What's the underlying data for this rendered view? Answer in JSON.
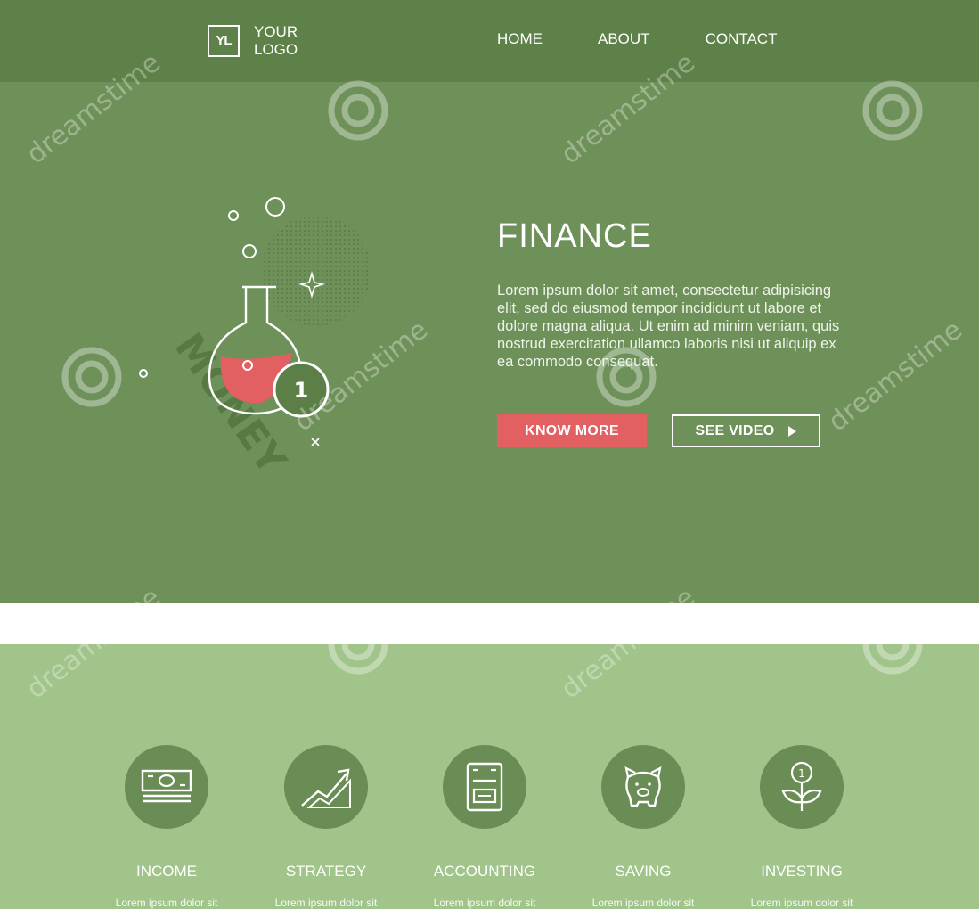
{
  "header": {
    "logo_mark": "YL",
    "logo_line1": "YOUR",
    "logo_line2": "LOGO",
    "nav": [
      {
        "label": "HOME",
        "active": true
      },
      {
        "label": "ABOUT",
        "active": false
      },
      {
        "label": "CONTACT",
        "active": false
      }
    ]
  },
  "hero": {
    "title": "FINANCE",
    "text": "Lorem ipsum dolor sit amet, consectetur adipisicing elit, sed do eiusmod tempor incididunt ut labore et dolore magna aliqua. Ut enim ad minim veniam, quis nostrud exercitation ullamco laboris nisi ut aliquip ex ea commodo consequat.",
    "primary_button": "KNOW MORE",
    "secondary_button": "SEE VIDEO",
    "illustration_word": "MONEY",
    "coin_number": "1"
  },
  "features": [
    {
      "label": "INCOME",
      "text": "Lorem ipsum dolor sit",
      "icon": "banknote-icon"
    },
    {
      "label": "STRATEGY",
      "text": "Lorem ipsum dolor sit",
      "icon": "growth-chart-icon"
    },
    {
      "label": "ACCOUNTING",
      "text": "Lorem ipsum dolor sit",
      "icon": "calculator-icon"
    },
    {
      "label": "SAVING",
      "text": "Lorem ipsum dolor sit",
      "icon": "piggy-bank-icon"
    },
    {
      "label": "INVESTING",
      "text": "Lorem ipsum dolor sit",
      "icon": "money-plant-icon"
    }
  ],
  "watermark": "dreamstime",
  "colors": {
    "header": "#5d8148",
    "hero": "#6e9159",
    "features": "#a1c48a",
    "icon_circle": "#6a8c55",
    "accent": "#e25f62"
  }
}
